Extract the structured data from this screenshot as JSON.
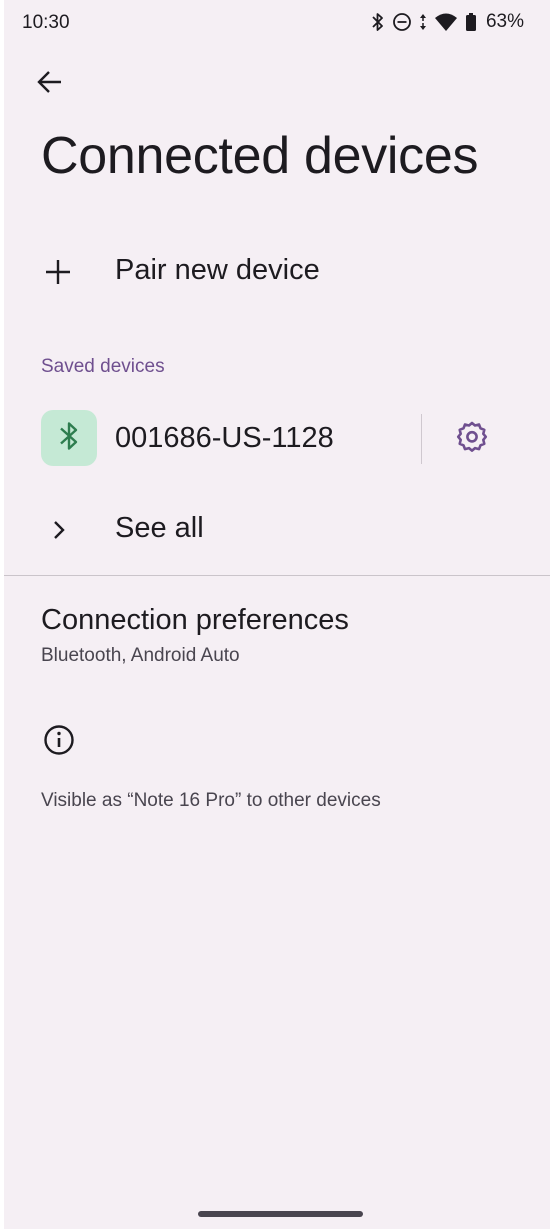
{
  "status_bar": {
    "time": "10:30",
    "battery_percent": "63%",
    "icons": [
      "bluetooth-icon",
      "dnd-icon",
      "data-arrows-icon",
      "wifi-icon",
      "battery-icon"
    ]
  },
  "header": {
    "back_icon": "back-arrow-icon",
    "title": "Connected devices"
  },
  "pair_new": {
    "icon": "plus-icon",
    "label": "Pair new device"
  },
  "saved_devices": {
    "header": "Saved devices",
    "items": [
      {
        "icon": "bluetooth-icon",
        "name": "001686-US-1128",
        "settings_icon": "gear-icon"
      }
    ],
    "see_all": {
      "icon": "chevron-right-icon",
      "label": "See all"
    }
  },
  "connection_preferences": {
    "title": "Connection preferences",
    "subtitle": "Bluetooth, Android Auto"
  },
  "footer_info": {
    "icon": "info-icon",
    "text": "Visible as “Note 16 Pro” to other devices"
  },
  "colors": {
    "background": "#f5eff4",
    "accent": "#6f4f8f",
    "device_icon_bg": "#c5e9d5",
    "bluetooth_green": "#2e7d4f"
  }
}
